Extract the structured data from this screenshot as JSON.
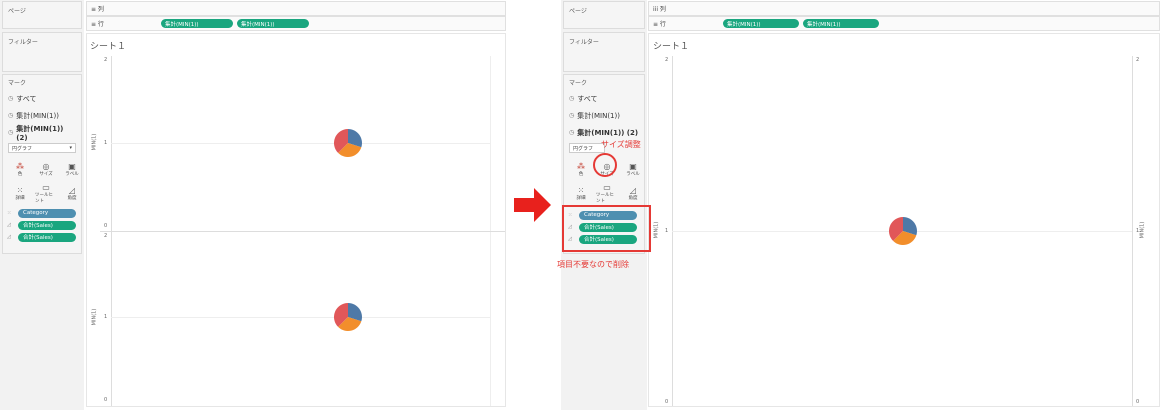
{
  "colors": {
    "accent_green": "#1aa67f",
    "pill_blue": "#4e8fb0",
    "annotation_red": "#e53935",
    "pie_blue": "#4e79a7",
    "pie_orange": "#f28e2b",
    "pie_red": "#e15759"
  },
  "left": {
    "pages_label": "ページ",
    "filters_label": "フィルター",
    "marks_label": "マーク",
    "columns_label": "≡ 列",
    "rows_label": "≡ 行",
    "row_pills": [
      "集計(MIN(1))",
      "集計(MIN(1))"
    ],
    "marks_items": [
      "すべて",
      "集計(MIN(1))",
      "集計(MIN(1)) (2)"
    ],
    "dropdown_value": "円グラフ",
    "buttons": [
      {
        "label": "色",
        "icon": "color-icon"
      },
      {
        "label": "サイズ",
        "icon": "size-icon"
      },
      {
        "label": "ラベル",
        "icon": "label-icon"
      },
      {
        "label": "詳細",
        "icon": "detail-icon"
      },
      {
        "label": "ツールヒント",
        "icon": "tooltip-icon"
      },
      {
        "label": "角度",
        "icon": "angle-icon"
      }
    ],
    "fields": [
      "Category",
      "合計(Sales)",
      "合計(Sales)"
    ],
    "sheet_title": "シート１",
    "y_axis_label": "MIN(1)",
    "ticks": [
      "2",
      "1",
      "0"
    ]
  },
  "right": {
    "pages_label": "ページ",
    "filters_label": "フィルター",
    "marks_label": "マーク",
    "columns_label": "iii 列",
    "rows_label": "≡ 行",
    "row_pills": [
      "集計(MIN(1))",
      "集計(MIN(1))"
    ],
    "marks_items": [
      "すべて",
      "集計(MIN(1))",
      "集計(MIN(1)) (2)"
    ],
    "dropdown_value": "円グラフ",
    "buttons": [
      {
        "label": "色",
        "icon": "color-icon"
      },
      {
        "label": "サイズ",
        "icon": "size-icon"
      },
      {
        "label": "ラベル",
        "icon": "label-icon"
      },
      {
        "label": "詳細",
        "icon": "detail-icon"
      },
      {
        "label": "ツールヒント",
        "icon": "tooltip-icon"
      },
      {
        "label": "角度",
        "icon": "angle-icon"
      }
    ],
    "fields": [
      "Category",
      "合計(Sales)",
      "合計(Sales)"
    ],
    "sheet_title": "シート１",
    "y_axis_label": "MIN(1)",
    "ticks": [
      "2",
      "1",
      "0"
    ],
    "annotation_size": "サイズ調整",
    "annotation_delete": "項目不要なので削除"
  }
}
